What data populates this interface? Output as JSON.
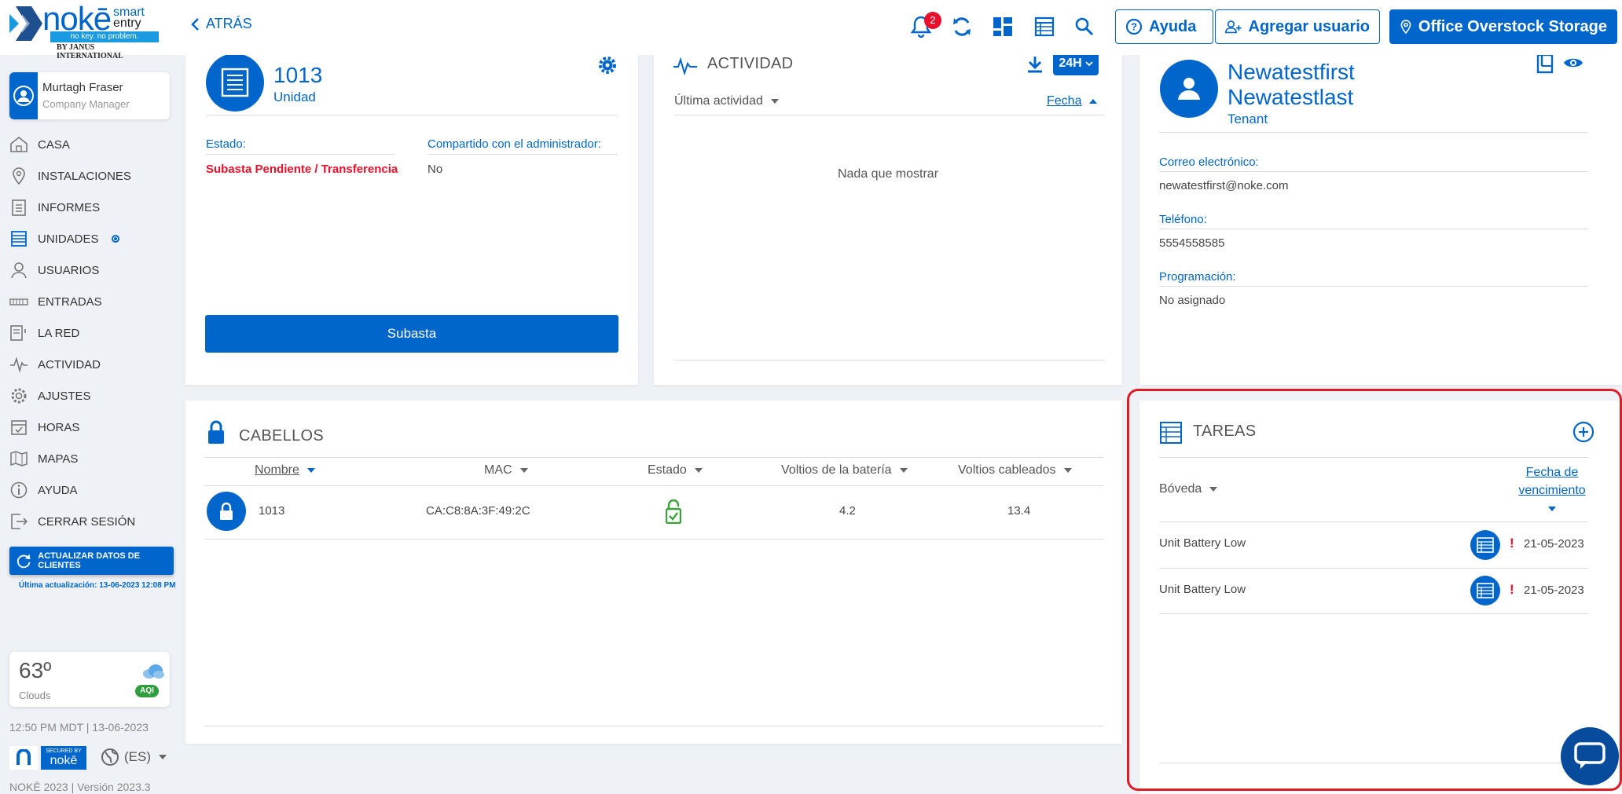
{
  "logo": {
    "word": "nokē",
    "smart": "smart",
    "entry": "entry",
    "tagline": "no key. no problem.",
    "by": "BY JANUS INTERNATIONAL"
  },
  "header": {
    "back_label": "ATRÁS",
    "notification_count": "2",
    "help_label": "Ayuda",
    "add_user_label": "Agregar usuario",
    "facility_label": "Office Overstock Storage"
  },
  "user": {
    "name": "Murtagh Fraser",
    "role": "Company Manager"
  },
  "nav": [
    {
      "label": "CASA",
      "icon": "house-icon"
    },
    {
      "label": "INSTALACIONES",
      "icon": "location-pin-icon"
    },
    {
      "label": "INFORMES",
      "icon": "clipboard-icon"
    },
    {
      "label": "UNIDADES",
      "icon": "units-list-icon",
      "active": true
    },
    {
      "label": "USUARIOS",
      "icon": "user-icon"
    },
    {
      "label": "ENTRADAS",
      "icon": "gate-icon"
    },
    {
      "label": "LA RED",
      "icon": "network-icon"
    },
    {
      "label": "ACTIVIDAD",
      "icon": "activity-icon"
    },
    {
      "label": "AJUSTES",
      "icon": "gear-icon"
    },
    {
      "label": "HORAS",
      "icon": "calendar-icon"
    },
    {
      "label": "MAPAS",
      "icon": "map-icon"
    },
    {
      "label": "AYUDA",
      "icon": "help-icon"
    },
    {
      "label": "CERRAR SESIÓN",
      "icon": "logout-icon"
    }
  ],
  "update": {
    "button_label": "ACTUALIZAR DATOS DE CLIENTES",
    "last_update": "Última actualización: 13-06-2023 12:08 PM"
  },
  "weather": {
    "temp": "63º",
    "condition": "Clouds",
    "aqi": "AQI"
  },
  "clock": "12:50 PM MDT | 13-06-2023",
  "secured": {
    "top": "SECURED BY",
    "brand": "nokē"
  },
  "language": "(ES)",
  "version": "NOKĒ 2023 | Versión 2023.3",
  "unit": {
    "number": "1013",
    "type": "Unidad",
    "status_label": "Estado:",
    "status_value": "Subasta Pendiente / Transferencia",
    "shared_label": "Compartido con el administrador:",
    "shared_value": "No",
    "auction_button": "Subasta"
  },
  "activity": {
    "title": "ACTIVIDAD",
    "range": "24H",
    "col_last": "Última actividad",
    "col_date": "Fecha",
    "empty": "Nada que mostrar"
  },
  "tenant": {
    "first": "Newatestfirst",
    "last": "Newatestlast",
    "role": "Tenant",
    "email_label": "Correo electrónico:",
    "email": "newatestfirst@noke.com",
    "phone_label": "Teléfono:",
    "phone": "5554558585",
    "schedule_label": "Programación:",
    "schedule": "No asignado"
  },
  "locks": {
    "title": "CABELLOS",
    "columns": [
      "Nombre",
      "MAC",
      "Estado",
      "Voltios de la batería",
      "Voltios cableados"
    ],
    "rows": [
      {
        "name": "1013",
        "mac": "CA:C8:8A:3F:49:2C",
        "battery": "4.2",
        "wired": "13.4"
      }
    ]
  },
  "tasks": {
    "title": "TAREAS",
    "col_vault": "Bóveda",
    "col_due_1": "Fecha de",
    "col_due_2": "vencimiento",
    "rows": [
      {
        "name": "Unit Battery Low",
        "alert": "!",
        "date": "21-05-2023"
      },
      {
        "name": "Unit Battery Low",
        "alert": "!",
        "date": "21-05-2023"
      }
    ]
  },
  "colors": {
    "primary": "#0066cc",
    "alert": "#e8102a",
    "success": "#3aa33a",
    "highlight": "#e01b24"
  }
}
